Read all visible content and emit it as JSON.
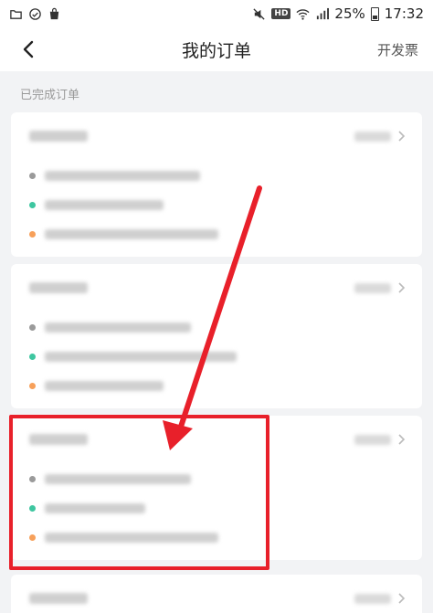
{
  "status_bar": {
    "battery": "25%",
    "time": "17:32",
    "hd_label": "HD",
    "icons": [
      "folder-icon",
      "sync-cloud-icon",
      "shopping-bag-icon",
      "mute-icon",
      "wifi-icon",
      "signal-icon",
      "battery-icon"
    ]
  },
  "header": {
    "title": "我的订单",
    "right_action": "开发票",
    "back_icon": "back-arrow-icon"
  },
  "section": {
    "label": "已完成订单"
  },
  "orders": [
    {
      "redacted": true
    },
    {
      "redacted": true
    },
    {
      "redacted": true
    },
    {
      "redacted": true
    }
  ],
  "annotation": {
    "arrow_color": "#e8202a",
    "box_color": "#e8202a"
  }
}
